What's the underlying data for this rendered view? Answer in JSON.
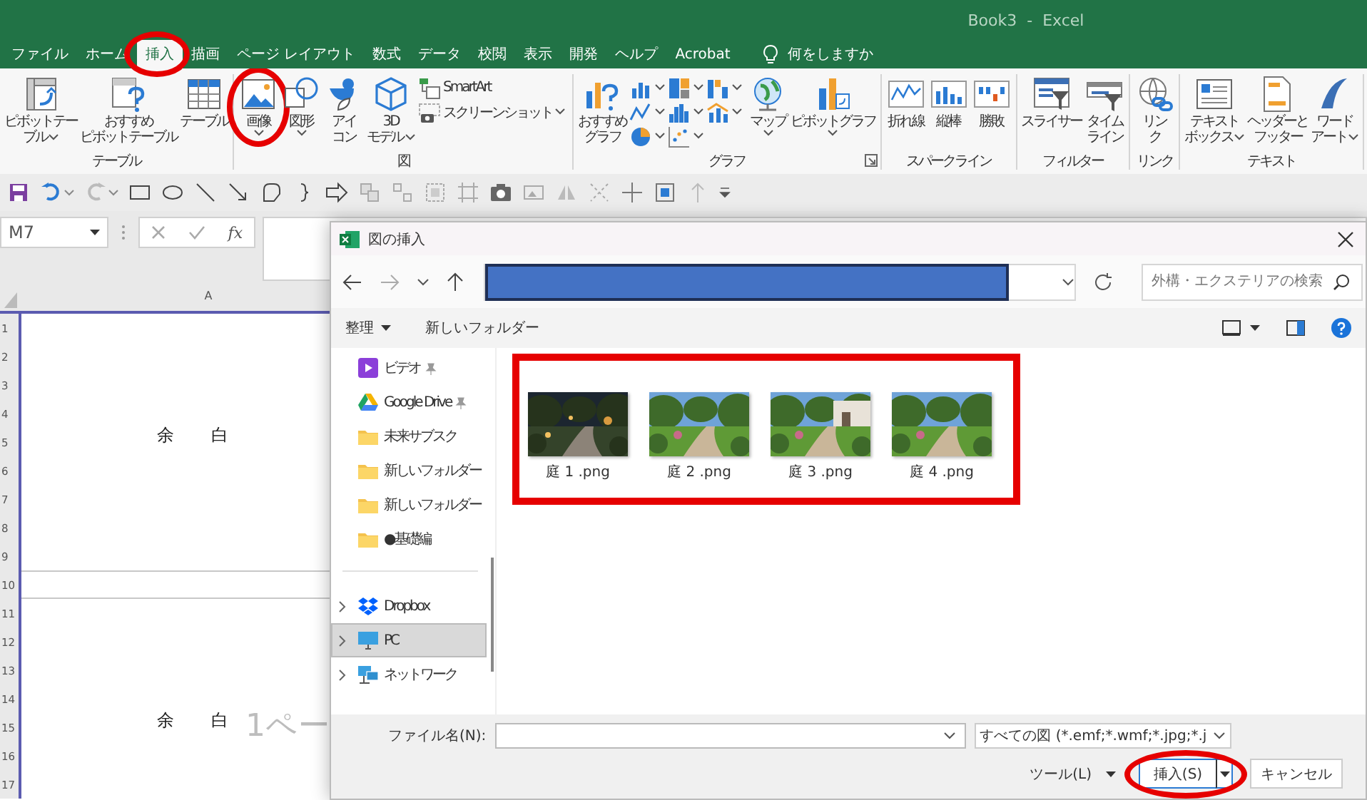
{
  "window": {
    "title": "Book3  -  Excel"
  },
  "ribbon_tabs": [
    {
      "label": "ファイル",
      "selected": false,
      "highlighted": false
    },
    {
      "label": "ホーム",
      "selected": false,
      "highlighted": false
    },
    {
      "label": "挿入",
      "selected": true,
      "highlighted": true
    },
    {
      "label": "描画",
      "selected": false,
      "highlighted": false
    },
    {
      "label": "ページ レイアウト",
      "selected": false,
      "highlighted": false
    },
    {
      "label": "数式",
      "selected": false,
      "highlighted": false
    },
    {
      "label": "データ",
      "selected": false,
      "highlighted": false
    },
    {
      "label": "校閲",
      "selected": false,
      "highlighted": false
    },
    {
      "label": "表示",
      "selected": false,
      "highlighted": false
    },
    {
      "label": "開発",
      "selected": false,
      "highlighted": false
    },
    {
      "label": "ヘルプ",
      "selected": false,
      "highlighted": false
    },
    {
      "label": "Acrobat",
      "selected": false,
      "highlighted": false
    }
  ],
  "tell_me": "何をしますか",
  "ribbon_groups": [
    {
      "label": "テーブル",
      "launcher": false,
      "buttons": [
        {
          "kind": "large",
          "lines": [
            "ピボットテー",
            "ブル"
          ],
          "dropdown": true,
          "highlighted": false
        },
        {
          "kind": "large",
          "lines": [
            "おすすめ",
            "ピボットテーブル"
          ],
          "dropdown": false,
          "highlighted": false
        },
        {
          "kind": "large",
          "lines": [
            "テーブル"
          ],
          "dropdown": false,
          "highlighted": false
        }
      ]
    },
    {
      "label": "図",
      "launcher": false,
      "buttons": [
        {
          "kind": "large",
          "lines": [
            "画像"
          ],
          "dropdown": true,
          "highlighted": true
        },
        {
          "kind": "large",
          "lines": [
            "図形"
          ],
          "dropdown": true,
          "highlighted": false
        },
        {
          "kind": "large",
          "lines": [
            "アイ",
            "コン"
          ],
          "dropdown": false,
          "highlighted": false
        },
        {
          "kind": "large",
          "lines": [
            "3D",
            "モデル"
          ],
          "dropdown": true,
          "highlighted": false
        },
        {
          "kind": "small",
          "label": "SmartArt",
          "dropdown": false,
          "highlighted": false
        },
        {
          "kind": "small",
          "label": "スクリーンショット",
          "dropdown": true,
          "highlighted": false
        }
      ]
    },
    {
      "label": "グラフ",
      "launcher": true,
      "buttons": [
        {
          "kind": "large",
          "lines": [
            "おすすめ",
            "グラフ"
          ],
          "dropdown": false,
          "highlighted": false
        },
        {
          "kind": "icon",
          "dropdown": true,
          "highlighted": false
        },
        {
          "kind": "icon",
          "dropdown": true,
          "highlighted": false
        },
        {
          "kind": "icon",
          "dropdown": true,
          "highlighted": false
        },
        {
          "kind": "icon",
          "dropdown": true,
          "highlighted": false
        },
        {
          "kind": "icon",
          "dropdown": true,
          "highlighted": false
        },
        {
          "kind": "icon",
          "dropdown": true,
          "highlighted": false
        },
        {
          "kind": "icon",
          "dropdown": true,
          "highlighted": false
        },
        {
          "kind": "icon",
          "dropdown": true,
          "highlighted": false
        },
        {
          "kind": "large",
          "lines": [
            "マップ"
          ],
          "dropdown": true,
          "highlighted": false
        },
        {
          "kind": "large",
          "lines": [
            "ピボットグラフ"
          ],
          "dropdown": true,
          "highlighted": false
        }
      ]
    },
    {
      "label": "スパークライン",
      "launcher": false,
      "buttons": [
        {
          "kind": "large",
          "lines": [
            "折れ線"
          ],
          "dropdown": false,
          "highlighted": false
        },
        {
          "kind": "large",
          "lines": [
            "縦棒"
          ],
          "dropdown": false,
          "highlighted": false
        },
        {
          "kind": "large",
          "lines": [
            "勝敗"
          ],
          "dropdown": false,
          "highlighted": false
        }
      ]
    },
    {
      "label": "フィルター",
      "launcher": false,
      "buttons": [
        {
          "kind": "large",
          "lines": [
            "スライサー"
          ],
          "dropdown": false,
          "highlighted": false
        },
        {
          "kind": "large",
          "lines": [
            "タイム",
            "ライン"
          ],
          "dropdown": false,
          "highlighted": false
        }
      ]
    },
    {
      "label": "リンク",
      "launcher": false,
      "buttons": [
        {
          "kind": "large",
          "lines": [
            "リン",
            "ク"
          ],
          "dropdown": false,
          "highlighted": false
        }
      ]
    },
    {
      "label": "テキスト",
      "launcher": false,
      "buttons": [
        {
          "kind": "large",
          "lines": [
            "テキスト",
            "ボックス"
          ],
          "dropdown": true,
          "highlighted": false
        },
        {
          "kind": "large",
          "lines": [
            "ヘッダーと",
            "フッター"
          ],
          "dropdown": false,
          "highlighted": false
        },
        {
          "kind": "large",
          "lines": [
            "ワード",
            "アート"
          ],
          "dropdown": true,
          "highlighted": false
        }
      ]
    }
  ],
  "formula_bar": {
    "name_box": "M7",
    "function_label": "fx"
  },
  "sheet": {
    "column_headers": [
      "A"
    ],
    "page_label": "1ペー",
    "rows": [
      {
        "header": "1",
        "kind": "page"
      },
      {
        "header": "2",
        "kind": "page"
      },
      {
        "header": "3",
        "kind": "page"
      },
      {
        "header": "4",
        "kind": "page"
      },
      {
        "header": "5",
        "kind": "page",
        "text": "余　白"
      },
      {
        "header": "6",
        "kind": "page"
      },
      {
        "header": "7",
        "kind": "page"
      },
      {
        "header": "8",
        "kind": "page"
      },
      {
        "header": "9",
        "kind": "page"
      },
      {
        "header": "10",
        "kind": "gap"
      },
      {
        "header": "11",
        "kind": "page"
      },
      {
        "header": "12",
        "kind": "page"
      },
      {
        "header": "13",
        "kind": "page"
      },
      {
        "header": "14",
        "kind": "page"
      },
      {
        "header": "15",
        "kind": "page",
        "text": "余　白"
      },
      {
        "header": "16",
        "kind": "page"
      },
      {
        "header": "17",
        "kind": "page"
      }
    ]
  },
  "dialog": {
    "title": "図の挿入",
    "search_placeholder": "外構・エクステリアの検索",
    "organize": "整理",
    "new_folder": "新しいフォルダー",
    "nav_sections": [
      [
        {
          "kind": "video",
          "label": "ビデオ",
          "pinned": true,
          "expandable": false,
          "selected": false
        },
        {
          "kind": "drive",
          "label": "Google Drive",
          "pinned": true,
          "expandable": false,
          "selected": false
        },
        {
          "kind": "folder",
          "label": "未来サブスク",
          "pinned": false,
          "expandable": false,
          "selected": false
        },
        {
          "kind": "folder",
          "label": "新しいフォルダー",
          "pinned": false,
          "expandable": false,
          "selected": false
        },
        {
          "kind": "folder",
          "label": "新しいフォルダー",
          "pinned": false,
          "expandable": false,
          "selected": false
        },
        {
          "kind": "folder",
          "label": "●基礎編",
          "pinned": false,
          "expandable": false,
          "selected": false
        }
      ],
      [
        {
          "kind": "dropbox",
          "label": "Dropbox",
          "pinned": false,
          "expandable": true,
          "selected": false
        },
        {
          "kind": "pc",
          "label": "PC",
          "pinned": false,
          "expandable": true,
          "selected": true
        },
        {
          "kind": "network",
          "label": "ネットワーク",
          "pinned": false,
          "expandable": true,
          "selected": false
        }
      ]
    ],
    "files": [
      {
        "name": "庭 1 .png"
      },
      {
        "name": "庭 2 .png"
      },
      {
        "name": "庭 3 .png"
      },
      {
        "name": "庭 4 .png"
      }
    ],
    "files_highlighted": true,
    "file_name_label": "ファイル名(N):",
    "file_type": "すべての図 (*.emf;*.wmf;*.jpg;*.j",
    "tools": "ツール(L)",
    "insert": {
      "label": "挿入(S)",
      "highlighted": true
    },
    "cancel": "キャンセル"
  }
}
